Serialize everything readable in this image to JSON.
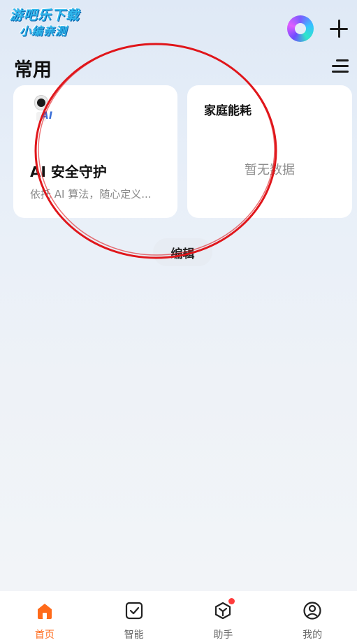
{
  "watermark": {
    "line1": "游吧乐下载",
    "line2": "小编亲测"
  },
  "header": {
    "section_title": "常用",
    "logo_icon": "app-logo-icon",
    "add_icon": "plus-icon",
    "menu_icon": "menu-icon"
  },
  "cards": {
    "ai": {
      "title": "AI 安全守护",
      "description": "依托 AI 算法，随心定义...",
      "icon": "security-camera-icon",
      "icon_text": "AI"
    },
    "energy": {
      "title": "家庭能耗",
      "empty_text": "暂无数据"
    }
  },
  "edit_label": "编辑",
  "nav": {
    "items": [
      {
        "label": "首页",
        "icon": "home-icon",
        "active": true
      },
      {
        "label": "智能",
        "icon": "checkbox-icon",
        "active": false
      },
      {
        "label": "助手",
        "icon": "assistant-icon",
        "active": false,
        "badge": true
      },
      {
        "label": "我的",
        "icon": "profile-icon",
        "active": false
      }
    ]
  },
  "colors": {
    "accent": "#ff6a1a",
    "annotation": "#e0161b",
    "badge": "#ff3b3b"
  }
}
